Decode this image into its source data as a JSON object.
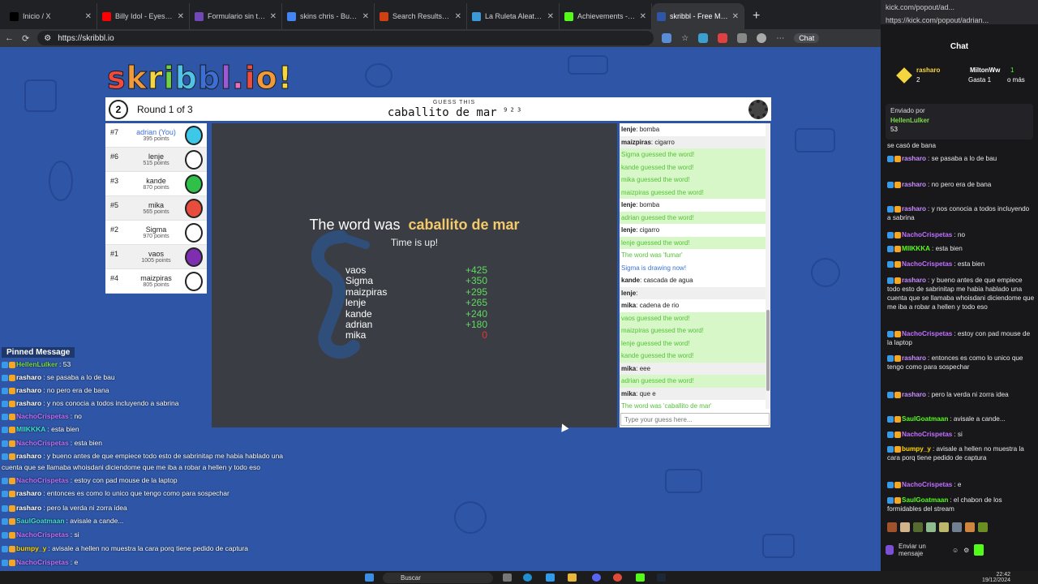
{
  "browser": {
    "tabs": [
      {
        "title": "Inicio / X",
        "icon": "x-logo-icon",
        "color": "#000000"
      },
      {
        "title": "Billy Idol - Eyes Wit",
        "icon": "youtube-icon",
        "color": "#ff0000"
      },
      {
        "title": "Formulario sin título - F",
        "icon": "forms-icon",
        "color": "#7248b9"
      },
      {
        "title": "skins chris - Buscar con",
        "icon": "google-icon",
        "color": "#4285f4"
      },
      {
        "title": "Search Results for 'skin",
        "icon": "site-icon",
        "color": "#d04010"
      },
      {
        "title": "La Ruleta Aleatoria",
        "icon": "wheel-icon",
        "color": "#3a9ad9"
      },
      {
        "title": "Achievements - Kick Da",
        "icon": "kick-icon",
        "color": "#53fc18"
      },
      {
        "title": "skribbl - Free Multip",
        "icon": "skribbl-icon",
        "color": "#2f56a6",
        "active": true
      }
    ],
    "url": "https://skribbl.io",
    "copilot_label": "Chat"
  },
  "game": {
    "logo": "skribbl.io!",
    "round_number": "2",
    "round_text": "Round 1 of 3",
    "guess_label": "GUESS THIS",
    "hint_word": "caballito de mar",
    "hint_sup": "9 2 3",
    "players": [
      {
        "rank": "#7",
        "name": "adrian (You)",
        "points": "395 points",
        "me": true,
        "avatar_color": "#3ec8e8"
      },
      {
        "rank": "#6",
        "name": "lenje",
        "points": "515 points",
        "avatar_color": "#ffffff"
      },
      {
        "rank": "#3",
        "name": "kande",
        "points": "870 points",
        "avatar_color": "#2fc04a"
      },
      {
        "rank": "#5",
        "name": "mika",
        "points": "565 points",
        "avatar_color": "#e74c3c"
      },
      {
        "rank": "#2",
        "name": "Sigma",
        "points": "970 points",
        "avatar_color": "#ffffff"
      },
      {
        "rank": "#1",
        "name": "vaos",
        "points": "1005 points",
        "avatar_color": "#7d2fb0"
      },
      {
        "rank": "#4",
        "name": "maizpiras",
        "points": "805 points",
        "avatar_color": "#ffffff"
      }
    ],
    "overlay_prefix": "The word was",
    "overlay_word": "caballito de mar",
    "overlay_sub": "Time is up!",
    "scores": [
      {
        "name": "vaos",
        "pts": "+425"
      },
      {
        "name": "Sigma",
        "pts": "+350"
      },
      {
        "name": "maizpiras",
        "pts": "+295"
      },
      {
        "name": "lenje",
        "pts": "+265"
      },
      {
        "name": "kande",
        "pts": "+240"
      },
      {
        "name": "adrian",
        "pts": "+180"
      },
      {
        "name": "mika",
        "pts": "0"
      }
    ],
    "chat": [
      {
        "user": "lenje",
        "text": "bomba",
        "type": "normal"
      },
      {
        "user": "maizpiras",
        "text": "cigarro",
        "type": "alt"
      },
      {
        "user": "",
        "text": "Sigma guessed the word!",
        "type": "green"
      },
      {
        "user": "",
        "text": "kande guessed the word!",
        "type": "green"
      },
      {
        "user": "",
        "text": "mika guessed the word!",
        "type": "green"
      },
      {
        "user": "",
        "text": "maizpiras guessed the word!",
        "type": "green"
      },
      {
        "user": "lenje",
        "text": "bomba",
        "type": "normal"
      },
      {
        "user": "",
        "text": "adrian guessed the word!",
        "type": "green"
      },
      {
        "user": "lenje",
        "text": "cigarro",
        "type": "normal"
      },
      {
        "user": "",
        "text": "lenje guessed the word!",
        "type": "green"
      },
      {
        "user": "",
        "text": "The word was 'fumar'",
        "type": "greentext"
      },
      {
        "user": "",
        "text": "Sigma is drawing now!",
        "type": "blue"
      },
      {
        "user": "kande",
        "text": "cascada de agua",
        "type": "normal"
      },
      {
        "user": "lenje",
        "text": "",
        "type": "alt"
      },
      {
        "user": "mika",
        "text": "cadena de rio",
        "type": "normal"
      },
      {
        "user": "",
        "text": "vaos guessed the word!",
        "type": "green"
      },
      {
        "user": "",
        "text": "maizpiras guessed the word!",
        "type": "green"
      },
      {
        "user": "",
        "text": "lenje guessed the word!",
        "type": "green"
      },
      {
        "user": "",
        "text": "kande guessed the word!",
        "type": "green"
      },
      {
        "user": "mika",
        "text": "eee",
        "type": "alt"
      },
      {
        "user": "",
        "text": "adrian guessed the word!",
        "type": "green"
      },
      {
        "user": "mika",
        "text": "que e",
        "type": "alt"
      },
      {
        "user": "",
        "text": "The word was 'caballito de mar'",
        "type": "greentext"
      }
    ],
    "guess_placeholder": "Type your guess here..."
  },
  "overlay_chat": {
    "pinned_label": "Pinned Message",
    "lines": [
      {
        "user": "HellenLulker",
        "text": "53",
        "color": "#7ddc4a"
      },
      {
        "user": "rasharo",
        "text": "se pasaba a lo de bau",
        "color": "#ffffff"
      },
      {
        "user": "rasharo",
        "text": "no pero era de bana",
        "color": "#ffffff"
      },
      {
        "user": "rasharo",
        "text": "y nos conocia a todos incluyendo a sabrina",
        "color": "#ffffff"
      },
      {
        "user": "NachoCrispetas",
        "text": "no",
        "color": "#c070ff"
      },
      {
        "user": "MIIKKKA",
        "text": "esta bien",
        "color": "#40e0d0"
      },
      {
        "user": "NachoCrispetas",
        "text": "esta bien",
        "color": "#c070ff"
      },
      {
        "user": "rasharo",
        "text": "y bueno antes de que empiece todo esto de sabrinitap me habia hablado una",
        "color": "#ffffff"
      },
      {
        "user": "",
        "text": "cuenta que se llamaba whoisdani diciendome que me iba a robar a hellen y todo eso",
        "color": "#ffffff"
      },
      {
        "user": "NachoCrispetas",
        "text": "estoy con pad mouse de la laptop",
        "color": "#c070ff"
      },
      {
        "user": "rasharo",
        "text": "entonces es como lo unico que tengo como para sospechar",
        "color": "#ffffff"
      },
      {
        "user": "rasharo",
        "text": "pero la verda ni zorra idea",
        "color": "#ffffff"
      },
      {
        "user": "SaulGoatmaan",
        "text": "avisale a cande...",
        "color": "#40e0d0"
      },
      {
        "user": "NachoCrispetas",
        "text": "si",
        "color": "#c070ff"
      },
      {
        "user": "bumpy_y",
        "text": "avisale a hellen      no muestra la cara porq tiene pedido de captura",
        "color": "#ffd700"
      },
      {
        "user": "NachoCrispetas",
        "text": "e",
        "color": "#c070ff"
      },
      {
        "user": "SaulGoatmaan",
        "text": "el chabon de los formidables del stream",
        "color": "#40e0d0"
      }
    ]
  },
  "kick_panel": {
    "url": "https://kick.com/popout/adrian...",
    "tab_title": "kick.com/popout/ad...",
    "title": "Chat",
    "gift_user1": "rasharo",
    "gift_count1": "2",
    "gift_user2": "MiltonWw",
    "gift_count2": "1",
    "gift_text": "Gasta 1",
    "gift_more": "o más",
    "pinned_by": "Enviado por",
    "pinned_user": "HellenLulker",
    "pinned_text": "53",
    "messages": [
      {
        "user": "",
        "text": "se casó de bana",
        "color": "#ffffff"
      },
      {
        "user": "rasharo",
        "text": "se pasaba a lo de bau",
        "color": "#c78bff"
      },
      {
        "user": "rasharo",
        "text": "no pero era de bana",
        "color": "#c78bff"
      },
      {
        "user": "rasharo",
        "text": "y nos conocia a todos incluyendo a sabrina",
        "color": "#c78bff"
      },
      {
        "user": "NachoCrispetas",
        "text": "no",
        "color": "#c070ff"
      },
      {
        "user": "MIIKKKA",
        "text": "esta bien",
        "color": "#53fc18"
      },
      {
        "user": "NachoCrispetas",
        "text": "esta bien",
        "color": "#c070ff"
      },
      {
        "user": "rasharo",
        "text": "y bueno antes de que empiece todo esto de sabrinitap me habia hablado una cuenta que se llamaba whoisdani diciendome que me iba a robar a hellen y todo eso",
        "color": "#c78bff"
      },
      {
        "user": "NachoCrispetas",
        "text": "estoy con pad mouse de la laptop",
        "color": "#c070ff"
      },
      {
        "user": "rasharo",
        "text": "entonces es como lo unico que tengo como para sospechar",
        "color": "#c78bff"
      },
      {
        "user": "rasharo",
        "text": "pero la verda ni zorra idea",
        "color": "#c78bff"
      },
      {
        "user": "SaulGoatmaan",
        "text": "avisale a cande...",
        "color": "#53fc18"
      },
      {
        "user": "NachoCrispetas",
        "text": "si",
        "color": "#c070ff"
      },
      {
        "user": "bumpy_y",
        "text": "avisale a hellen      no muestra la cara porq tiene pedido de captura",
        "color": "#ffd700"
      },
      {
        "user": "NachoCrispetas",
        "text": "e",
        "color": "#c070ff"
      },
      {
        "user": "SaulGoatmaan",
        "text": "el chabon de los formidables del stream",
        "color": "#53fc18"
      }
    ],
    "send_label": "Enviar un mensaje"
  },
  "taskbar": {
    "search_label": "Buscar",
    "time": "22:42",
    "date": "19/12/2024"
  }
}
